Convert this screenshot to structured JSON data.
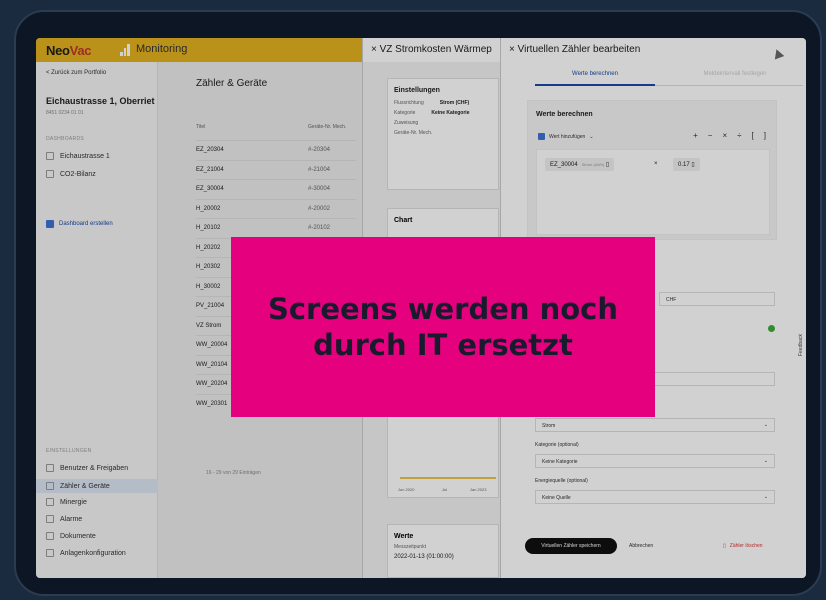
{
  "topbar": {
    "logo_a": "Neo",
    "logo_b": "Vac",
    "module": "Monitoring"
  },
  "sidebar": {
    "back": "< Zurück zum Portfolio",
    "site_title": "Eichaustrasse 1, Oberriet",
    "site_sub": "8451 0234 01 01",
    "section_dashboards": "DASHBOARDS",
    "dashboards": [
      {
        "label": "Eichaustrasse 1"
      },
      {
        "label": "CO2-Bilanz"
      }
    ],
    "dash_create": "Dashboard erstellen",
    "section_settings": "EINSTELLUNGEN",
    "settings": [
      {
        "label": "Benutzer & Freigaben"
      },
      {
        "label": "Zähler & Geräte"
      },
      {
        "label": "Minergie"
      },
      {
        "label": "Alarme"
      },
      {
        "label": "Dokumente"
      },
      {
        "label": "Anlagenkonfiguration"
      }
    ]
  },
  "main": {
    "title": "Zähler & Geräte",
    "col1": "Titel",
    "col2": "Geräte-Nr. Mech.",
    "rows": [
      {
        "a": "EZ_20304",
        "b": "#-20304"
      },
      {
        "a": "EZ_21004",
        "b": "#-21004"
      },
      {
        "a": "EZ_30004",
        "b": "#-30004"
      },
      {
        "a": "H_20002",
        "b": "#-20002"
      },
      {
        "a": "H_20102",
        "b": "#-20102"
      },
      {
        "a": "H_20202",
        "b": ""
      },
      {
        "a": "H_20302",
        "b": ""
      },
      {
        "a": "H_30002",
        "b": ""
      },
      {
        "a": "PV_21004",
        "b": ""
      },
      {
        "a": "VZ Strom",
        "b": ""
      },
      {
        "a": "WW_20004",
        "b": ""
      },
      {
        "a": "WW_20104",
        "b": ""
      },
      {
        "a": "WW_20204",
        "b": ""
      },
      {
        "a": "WW_20301",
        "b": "#-20301"
      }
    ],
    "footer": "16 - 29 von 29 Einträgen"
  },
  "mid_panel": {
    "title": "× VZ Stromkosten Wärmep",
    "settings_title": "Einstellungen",
    "kv": [
      {
        "k": "Flussrichtung",
        "v": "Strom (CHF)"
      },
      {
        "k": "Kategorie",
        "v": "Keine Kategorie"
      },
      {
        "k": "Zuweisung",
        "v": ""
      },
      {
        "k": "Geräte-Nr. Mech.",
        "v": ""
      }
    ],
    "chart_title": "Chart",
    "chart_y": "300",
    "chart_x1": "Jun 2020",
    "chart_x2": "Jul",
    "chart_x3": "Jan 2023",
    "values_title": "Werte",
    "values_sub": "Messzeitpunkt",
    "value1": "2022-01-13 (01:00:00)",
    "value2": "2022-01-12 (01:00:00)"
  },
  "right_panel": {
    "title": "× Virtuellen Zähler bearbeiten",
    "tab_active": "Werte berechnen",
    "tab_inactive": "Meldeintervall festlegen",
    "calc_title": "Werte berechnen",
    "add_value": "Wert hinzufügen",
    "ops": [
      "+",
      "−",
      "×",
      "÷",
      "[",
      "]"
    ],
    "chip1_name": "EZ_30004",
    "chip1_unit": "Strom (kWh)",
    "op_mult": "×",
    "chip2": "0.17",
    "currency": "CHF",
    "unit_value": "Strom",
    "category_label": "Kategorie (optional)",
    "category_value": "Keine Kategorie",
    "energy_label": "Energiequelle (optional)",
    "energy_value": "Keine Quelle",
    "save": "Virtuellen Zähler speichern",
    "cancel": "Abbrechen",
    "delete": "Zähler löschen",
    "feedback": "Feedback"
  },
  "banner": {
    "line1": "Screens werden noch",
    "line2": "durch IT ersetzt",
    "color": "#e5007e"
  }
}
